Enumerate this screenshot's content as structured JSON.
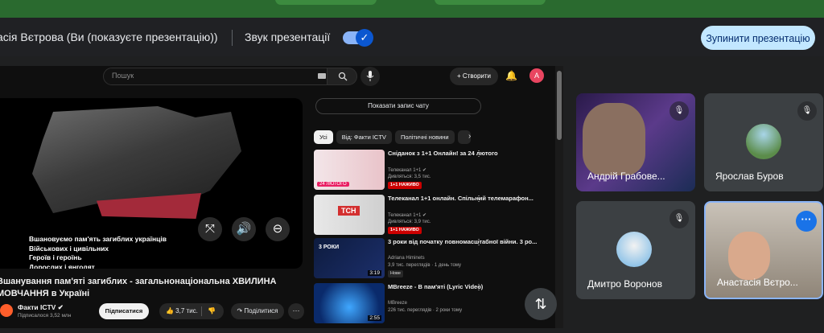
{
  "presentation_bar": {
    "presenting_text": "асія Вєтрова (Ви (показуєте презентацію))",
    "sound_label": "Звук презентації",
    "stop_label": "Зупинити презентацію"
  },
  "youtube": {
    "search_placeholder": "Пошук",
    "create_label": "+ Створити",
    "avatar_letter": "A",
    "video_overlay_text": "Вшановуємо пам'ять загиблих українців\nВійськових і цивільних\nГероїв і героїнь\nДорослих і янголят",
    "video_title": "Вшанування пам'яті загиблих - загальнонаціональна ХВИЛИНА МОВЧАННЯ в Україні",
    "channel_name": "Факти ICTV ✔",
    "channel_subs": "Підписалося 3,52 млн",
    "subscribe_label": "Підписатися",
    "likes": "👍 3,7 тис.",
    "dislike_icon": "👎",
    "share_label": "↷ Поділитися",
    "more_label": "···",
    "chat_button": "Показати запис чату",
    "chips": [
      "Усі",
      "Від: Факти ICTV",
      "Політичні новини",
      ""
    ],
    "recommendations": [
      {
        "title": "Сніданок з 1+1 Онлайн! за 24 лютого",
        "channel": "Телеканал 1+1 ✔",
        "meta": "Дивляться: 3,5 тис.",
        "badge": "1+1 НАЖИВО",
        "thumb_label": "24 ЛЮТОГО"
      },
      {
        "title": "Телеканал 1+1 онлайн. Спільний телемарафон...",
        "channel": "Телеканал 1+1 ✔",
        "meta": "Дивляться: 3,9 тис.",
        "badge": "1+1 НАЖИВО",
        "thumb_label": "TCH"
      },
      {
        "title": "3 роки від початку повномасштабної війни. 3 ро...",
        "channel": "Adriana Himinets",
        "meta": "3,9 тис. переглядів · 1 день тому",
        "badge": "Нове",
        "thumb_label": "3 РОКИ",
        "duration": "3:19"
      },
      {
        "title": "MBreeze - В пам'яті (Lyric Video)",
        "channel": "MBreeze",
        "meta": "226 тис. переглядів · 2 роки тому",
        "badge": "",
        "thumb_label": "",
        "duration": "2:55"
      }
    ]
  },
  "participants": [
    {
      "name": "Андрій Грабове...",
      "muted": true
    },
    {
      "name": "Ярослав Буров",
      "muted": true
    },
    {
      "name": "Дмитро Воронов",
      "muted": true
    },
    {
      "name": "Анастасія Вєтро...",
      "muted": false
    }
  ],
  "colors": {
    "accent": "#8ab4f8",
    "stop_button": "#c2e7ff",
    "top_strip": "#2a6a2f"
  }
}
